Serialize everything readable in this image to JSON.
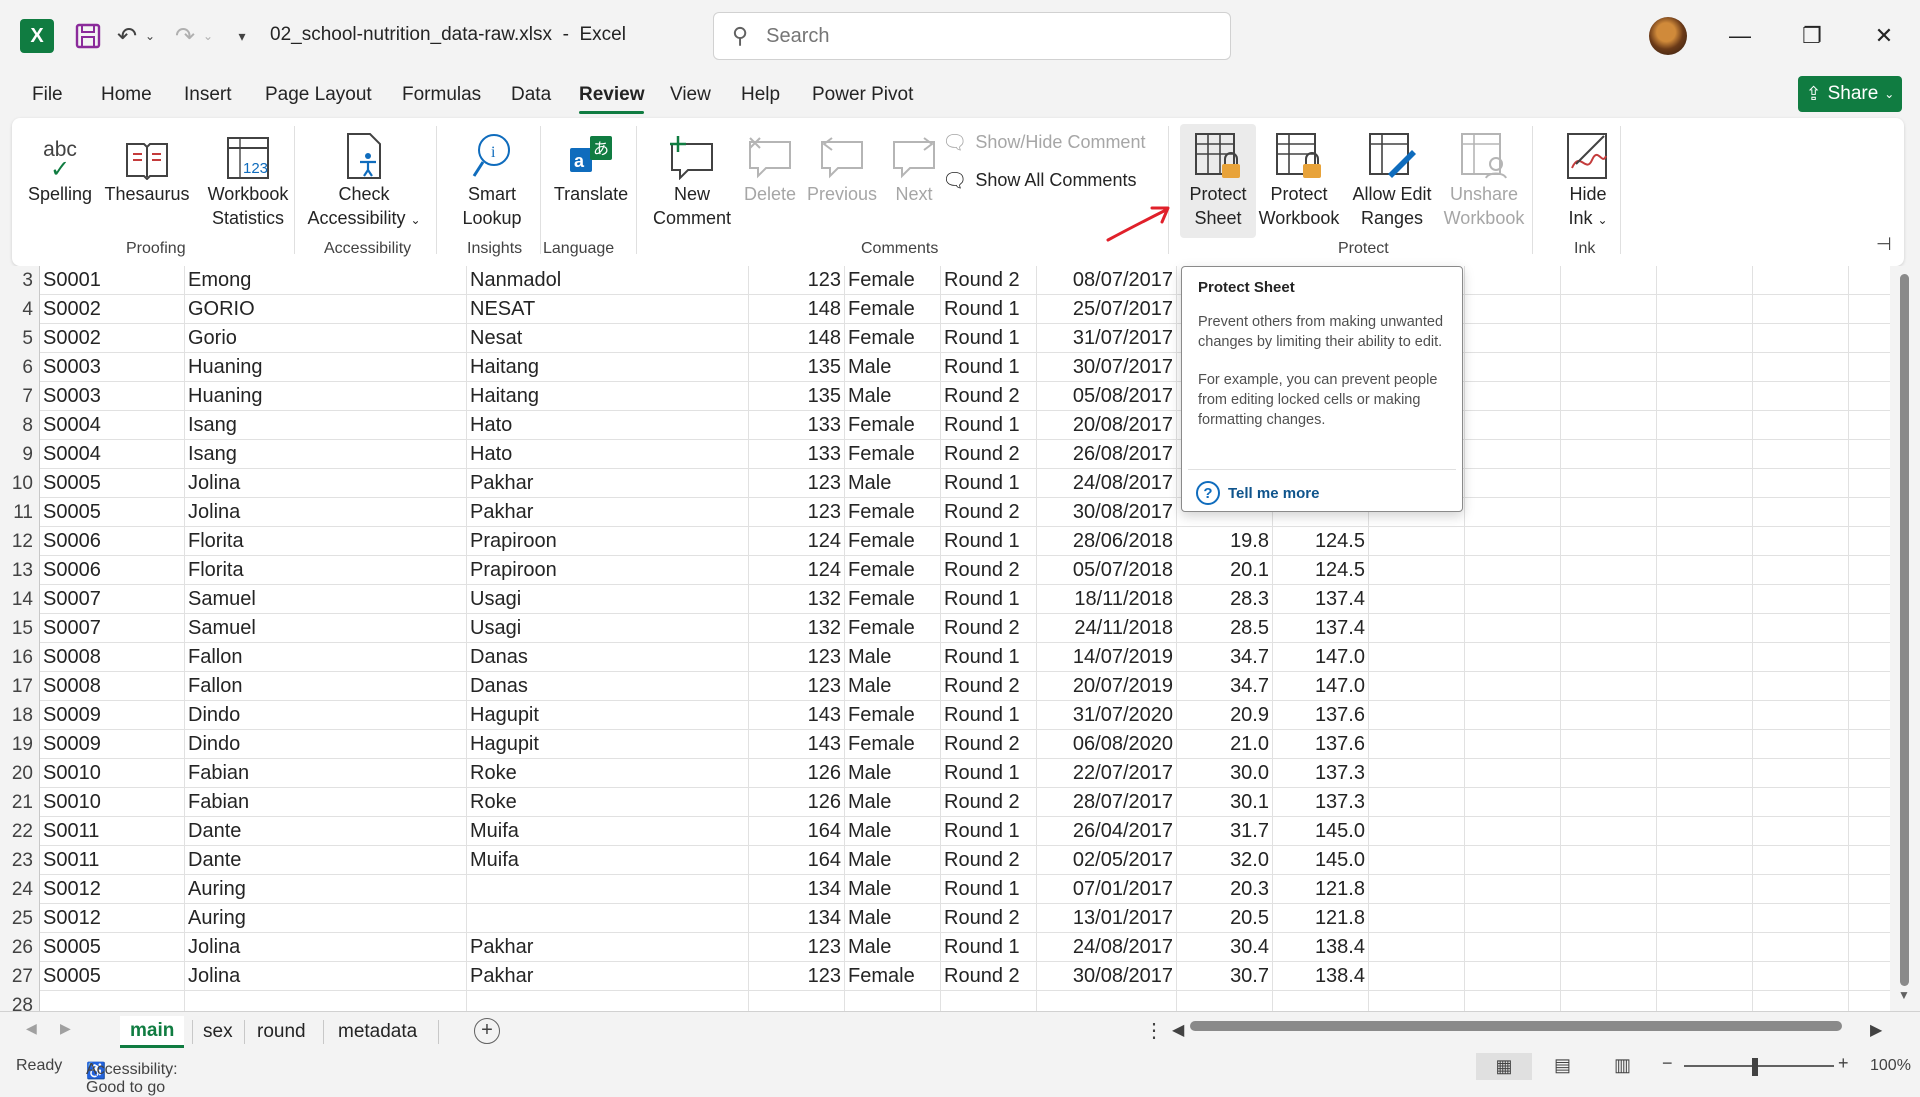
{
  "titlebar": {
    "filename": "02_school-nutrition_data-raw.xlsx",
    "separator": "-",
    "app": "Excel",
    "search_placeholder": "Search"
  },
  "menu": [
    "File",
    "Home",
    "Insert",
    "Page Layout",
    "Formulas",
    "Data",
    "Review",
    "View",
    "Help",
    "Power Pivot"
  ],
  "active_menu": "Review",
  "share_label": "Share",
  "ribbon": {
    "proofing": {
      "label": "Proofing",
      "spelling": "Spelling",
      "thesaurus": "Thesaurus",
      "workbook_stats_1": "Workbook",
      "workbook_stats_2": "Statistics",
      "abc": "abc"
    },
    "accessibility": {
      "label": "Accessibility",
      "check_1": "Check",
      "check_2": "Accessibility"
    },
    "insights": {
      "label": "Insights",
      "smart_1": "Smart",
      "smart_2": "Lookup"
    },
    "language": {
      "label": "Language",
      "translate": "Translate"
    },
    "comments": {
      "label": "Comments",
      "new_1": "New",
      "new_2": "Comment",
      "delete": "Delete",
      "previous": "Previous",
      "next": "Next",
      "show_hide": "Show/Hide Comment",
      "show_all": "Show All Comments"
    },
    "protect": {
      "label": "Protect",
      "sheet_1": "Protect",
      "sheet_2": "Sheet",
      "workbook_1": "Protect",
      "workbook_2": "Workbook",
      "allow_1": "Allow Edit",
      "allow_2": "Ranges",
      "unshare_1": "Unshare",
      "unshare_2": "Workbook"
    },
    "ink": {
      "label": "Ink",
      "hide_1": "Hide",
      "hide_2": "Ink"
    }
  },
  "tooltip": {
    "title": "Protect Sheet",
    "p1": "Prevent others from making unwanted changes by limiting their ability to edit.",
    "p2": "For example, you can prevent people from editing locked cells or making formatting changes.",
    "link": "Tell me more"
  },
  "rows": [
    [
      "3",
      "S0001",
      "Emong",
      "Nanmadol",
      "123",
      "Female",
      "Round 2",
      "08/07/2017",
      "",
      ""
    ],
    [
      "4",
      "S0002",
      "GORIO",
      "NESAT",
      "148",
      "Female",
      "Round 1",
      "25/07/2017",
      "",
      ""
    ],
    [
      "5",
      "S0002",
      "Gorio",
      "Nesat",
      "148",
      "Female",
      "Round 1",
      "31/07/2017",
      "",
      ""
    ],
    [
      "6",
      "S0003",
      "Huaning",
      "Haitang",
      "135",
      "Male",
      "Round 1",
      "30/07/2017",
      "",
      ""
    ],
    [
      "7",
      "S0003",
      "Huaning",
      "Haitang",
      "135",
      "Male",
      "Round 2",
      "05/08/2017",
      "",
      ""
    ],
    [
      "8",
      "S0004",
      "Isang",
      "Hato",
      "133",
      "Female",
      "Round 1",
      "20/08/2017",
      "",
      ""
    ],
    [
      "9",
      "S0004",
      "Isang",
      "Hato",
      "133",
      "Female",
      "Round 2",
      "26/08/2017",
      "",
      ""
    ],
    [
      "10",
      "S0005",
      "Jolina",
      "Pakhar",
      "123",
      "Male",
      "Round 1",
      "24/08/2017",
      "",
      ""
    ],
    [
      "11",
      "S0005",
      "Jolina",
      "Pakhar",
      "123",
      "Female",
      "Round 2",
      "30/08/2017",
      "",
      ""
    ],
    [
      "12",
      "S0006",
      "Florita",
      "Prapiroon",
      "124",
      "Female",
      "Round 1",
      "28/06/2018",
      "19.8",
      "124.5"
    ],
    [
      "13",
      "S0006",
      "Florita",
      "Prapiroon",
      "124",
      "Female",
      "Round 2",
      "05/07/2018",
      "20.1",
      "124.5"
    ],
    [
      "14",
      "S0007",
      "Samuel",
      "Usagi",
      "132",
      "Female",
      "Round 1",
      "18/11/2018",
      "28.3",
      "137.4"
    ],
    [
      "15",
      "S0007",
      "Samuel",
      "Usagi",
      "132",
      "Female",
      "Round 2",
      "24/11/2018",
      "28.5",
      "137.4"
    ],
    [
      "16",
      "S0008",
      "Fallon",
      "Danas",
      "123",
      "Male",
      "Round 1",
      "14/07/2019",
      "34.7",
      "147.0"
    ],
    [
      "17",
      "S0008",
      "Fallon",
      "Danas",
      "123",
      "Male",
      "Round 2",
      "20/07/2019",
      "34.7",
      "147.0"
    ],
    [
      "18",
      "S0009",
      "Dindo",
      "Hagupit",
      "143",
      "Female",
      "Round 1",
      "31/07/2020",
      "20.9",
      "137.6"
    ],
    [
      "19",
      "S0009",
      "Dindo",
      "Hagupit",
      "143",
      "Female",
      "Round 2",
      "06/08/2020",
      "21.0",
      "137.6"
    ],
    [
      "20",
      "S0010",
      "Fabian",
      "Roke",
      "126",
      "Male",
      "Round 1",
      "22/07/2017",
      "30.0",
      "137.3"
    ],
    [
      "21",
      "S0010",
      "Fabian",
      "Roke",
      "126",
      "Male",
      "Round 2",
      "28/07/2017",
      "30.1",
      "137.3"
    ],
    [
      "22",
      "S0011",
      "Dante",
      "Muifa",
      "164",
      "Male",
      "Round 1",
      "26/04/2017",
      "31.7",
      "145.0"
    ],
    [
      "23",
      "S0011",
      "Dante",
      "Muifa",
      "164",
      "Male",
      "Round 2",
      "02/05/2017",
      "32.0",
      "145.0"
    ],
    [
      "24",
      "S0012",
      "Auring",
      "",
      "134",
      "Male",
      "Round 1",
      "07/01/2017",
      "20.3",
      "121.8"
    ],
    [
      "25",
      "S0012",
      "Auring",
      "",
      "134",
      "Male",
      "Round 2",
      "13/01/2017",
      "20.5",
      "121.8"
    ],
    [
      "26",
      "S0005",
      "Jolina",
      "Pakhar",
      "123",
      "Male",
      "Round 1",
      "24/08/2017",
      "30.4",
      "138.4"
    ],
    [
      "27",
      "S0005",
      "Jolina",
      "Pakhar",
      "123",
      "Female",
      "Round 2",
      "30/08/2017",
      "30.7",
      "138.4"
    ],
    [
      "28",
      "",
      "",
      "",
      "",
      "",
      "",
      "",
      "",
      ""
    ]
  ],
  "sheets": [
    "main",
    "sex",
    "round",
    "metadata"
  ],
  "active_sheet": "main",
  "status": {
    "ready": "Ready",
    "accessibility": "Accessibility: Good to go",
    "zoom": "100%"
  }
}
